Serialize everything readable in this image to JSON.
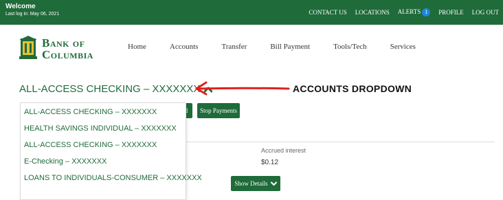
{
  "topbar": {
    "welcome": "Welcome",
    "last_login": "Last log in: May 06, 2021",
    "nav": [
      "CONTACT US",
      "LOCATIONS",
      "ALERTS",
      "PROFILE",
      "LOG OUT"
    ],
    "alerts_count": "1",
    "bg_color": "#1f6b3a"
  },
  "brand": {
    "line1": "Bank of",
    "line2": "Columbia",
    "icon": "bank-building-icon"
  },
  "main_nav": [
    "Home",
    "Accounts",
    "Transfer",
    "Bill Payment",
    "Tools/Tech",
    "Services"
  ],
  "account": {
    "title": "ALL-ACCESS CHECKING – XXXXXXX",
    "caret_icon": "chevron-up-icon"
  },
  "annotation": {
    "label": "ACCOUNTS DROPDOWN",
    "arrow_color": "#e0201b"
  },
  "buttons": {
    "partial": "d",
    "stop_payments": "Stop Payments",
    "show_details": "Show Details"
  },
  "interest": {
    "label": "Accrued interest",
    "value": "$0.12"
  },
  "dropdown": {
    "items": [
      "ALL-ACCESS CHECKING – XXXXXXX",
      "HEALTH SAVINGS INDIVIDUAL – XXXXXXX",
      "ALL-ACCESS CHECKING – XXXXXXX",
      "E-Checking – XXXXXXX",
      "LOANS TO INDIVIDUALS-CONSUMER – XXXXXXX"
    ]
  }
}
